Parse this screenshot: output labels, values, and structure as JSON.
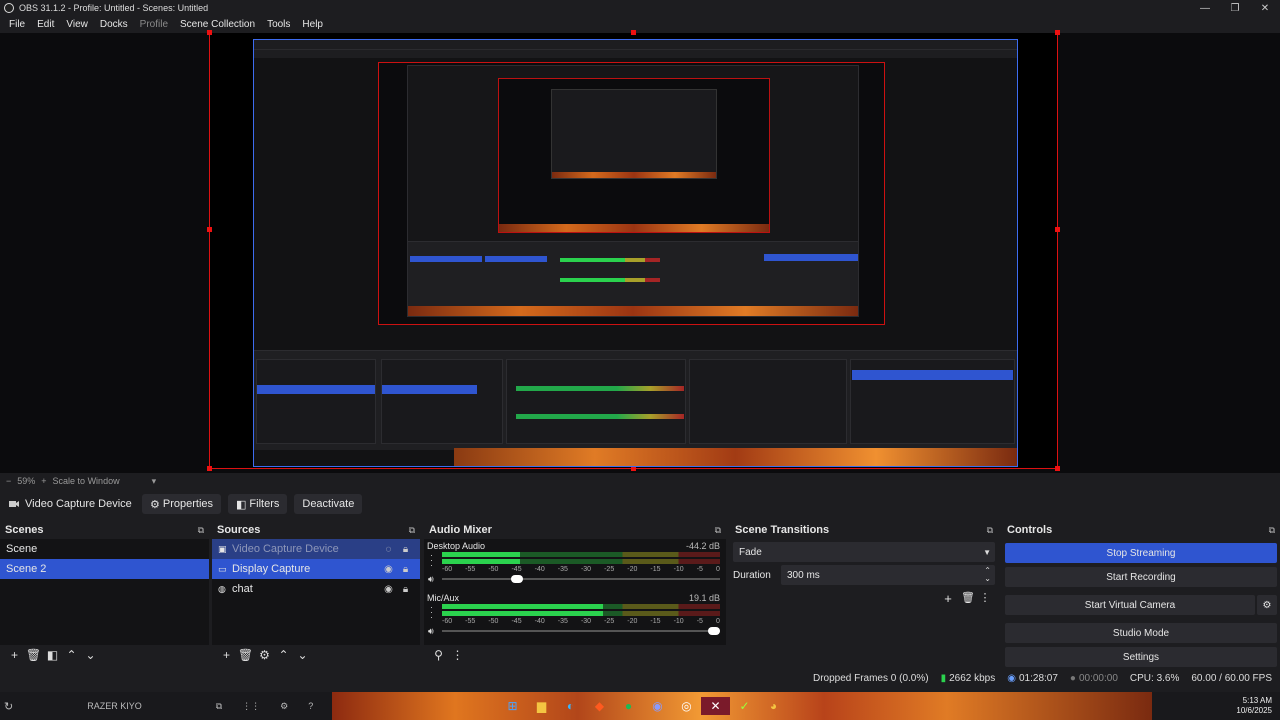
{
  "window": {
    "title": "OBS 31.1.2 - Profile: Untitled - Scenes: Untitled",
    "controls": [
      "—",
      "❐",
      "✕"
    ]
  },
  "menu": {
    "items": [
      "File",
      "Edit",
      "View",
      "Docks",
      "Profile",
      "Scene Collection",
      "Tools",
      "Help"
    ]
  },
  "zoom": {
    "minus": "−",
    "percent": "59%",
    "plus": "+",
    "mode": "Scale to Window"
  },
  "context": {
    "source_name": "Video Capture Device",
    "properties": "Properties",
    "filters": "Filters",
    "deactivate": "Deactivate"
  },
  "scenes": {
    "title": "Scenes",
    "items": [
      {
        "label": "Scene",
        "selected": false
      },
      {
        "label": "Scene 2",
        "selected": true
      }
    ]
  },
  "sources": {
    "title": "Sources",
    "items": [
      {
        "label": "Video Capture Device",
        "icon": "camera-icon",
        "dim": true
      },
      {
        "label": "Display Capture",
        "icon": "monitor-icon",
        "selected": true
      },
      {
        "label": "chat",
        "icon": "globe-icon"
      }
    ]
  },
  "audio": {
    "title": "Audio Mixer",
    "channels": [
      {
        "name": "Desktop Audio",
        "db": "-44.2 dB",
        "level": 0.28,
        "volume": 0.27
      },
      {
        "name": "Mic/Aux",
        "db": "19.1 dB",
        "level": 0.58,
        "volume": 0.98
      }
    ],
    "ticks": [
      "-60",
      "-55",
      "-50",
      "-45",
      "-40",
      "-35",
      "-30",
      "-25",
      "-20",
      "-15",
      "-10",
      "-5",
      "0"
    ]
  },
  "transitions": {
    "title": "Scene Transitions",
    "selected": "Fade",
    "duration_label": "Duration",
    "duration_value": "300 ms"
  },
  "controls": {
    "title": "Controls",
    "stop_streaming": "Stop Streaming",
    "start_recording": "Start Recording",
    "start_virtual_camera": "Start Virtual Camera",
    "studio_mode": "Studio Mode",
    "settings": "Settings"
  },
  "status": {
    "dropped": "Dropped Frames 0 (0.0%)",
    "bitrate": "2662 kbps",
    "stream_time": "01:28:07",
    "rec_time": "00:00:00",
    "cpu": "CPU: 3.6%",
    "fps": "60.00 / 60.00 FPS"
  },
  "taskbar": {
    "camera_name": "RAZER KIYO",
    "time": "5:13 AM",
    "date": "10/6/2025"
  },
  "colors": {
    "accent": "#2f55d0",
    "bounding_box": "#dd1111",
    "meter_green": "#2bd24e"
  }
}
